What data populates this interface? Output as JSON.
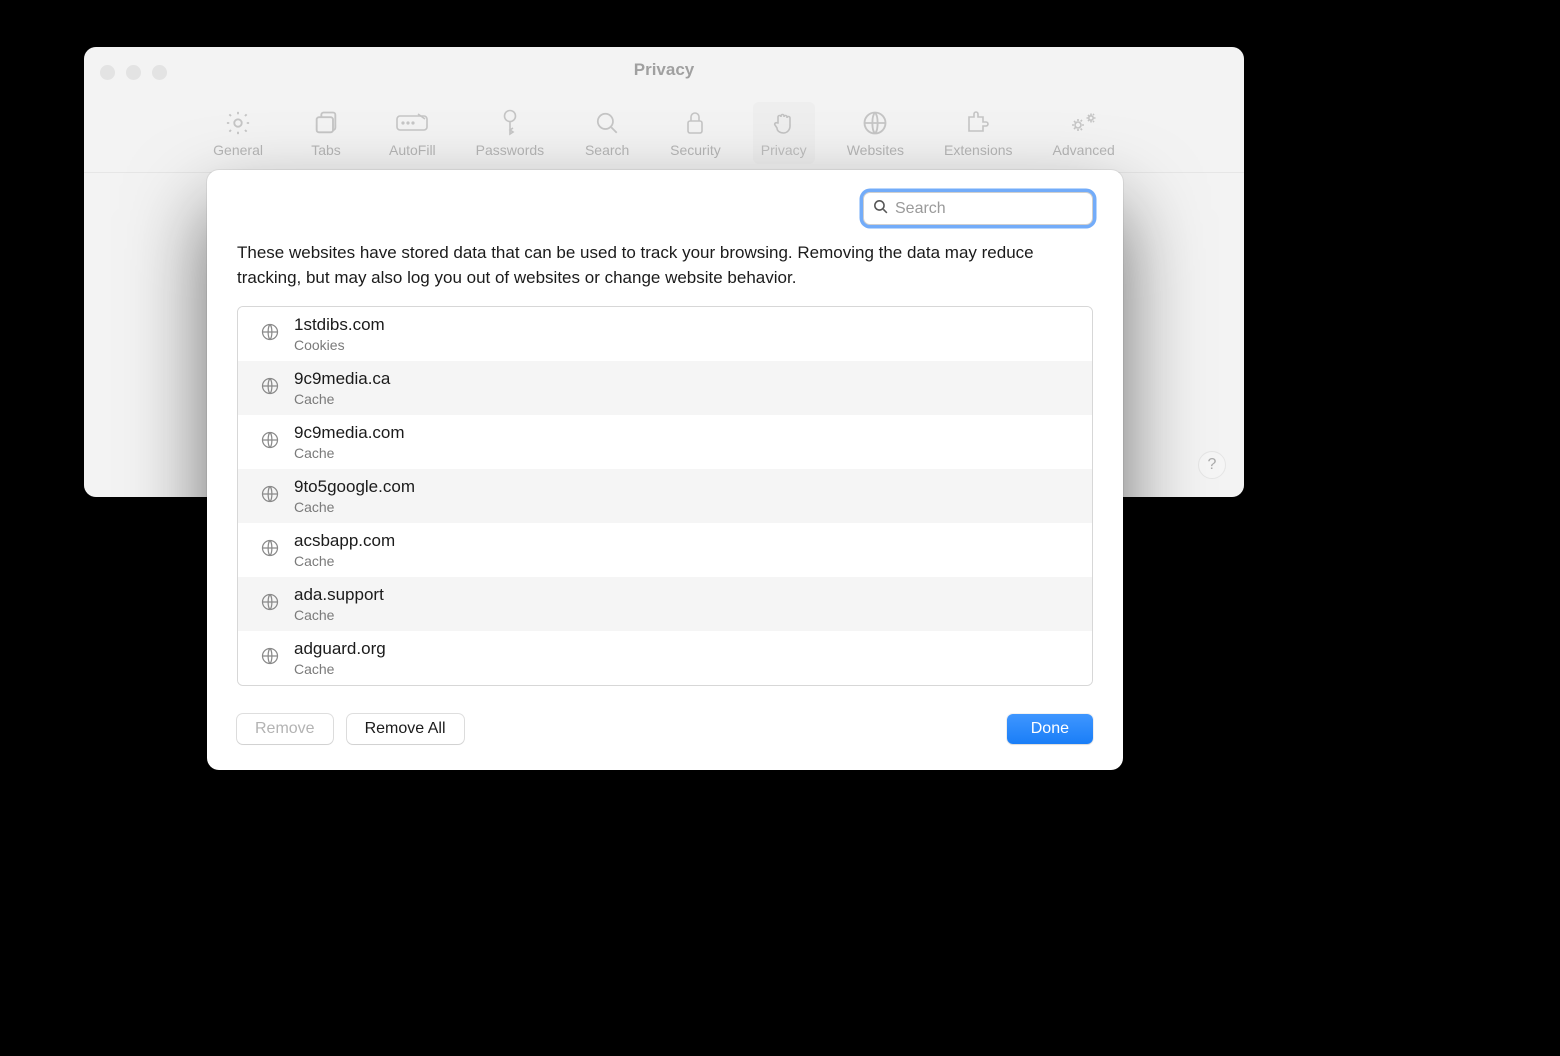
{
  "window": {
    "title": "Privacy"
  },
  "toolbar": {
    "items": [
      {
        "label": "General"
      },
      {
        "label": "Tabs"
      },
      {
        "label": "AutoFill"
      },
      {
        "label": "Passwords"
      },
      {
        "label": "Search"
      },
      {
        "label": "Security"
      },
      {
        "label": "Privacy"
      },
      {
        "label": "Websites"
      },
      {
        "label": "Extensions"
      },
      {
        "label": "Advanced"
      }
    ]
  },
  "sheet": {
    "search_placeholder": "Search",
    "description": "These websites have stored data that can be used to track your browsing. Removing the data may reduce tracking, but may also log you out of websites or change website behavior.",
    "rows": [
      {
        "domain": "1stdibs.com",
        "detail": "Cookies"
      },
      {
        "domain": "9c9media.ca",
        "detail": "Cache"
      },
      {
        "domain": "9c9media.com",
        "detail": "Cache"
      },
      {
        "domain": "9to5google.com",
        "detail": "Cache"
      },
      {
        "domain": "acsbapp.com",
        "detail": "Cache"
      },
      {
        "domain": "ada.support",
        "detail": "Cache"
      },
      {
        "domain": "adguard.org",
        "detail": "Cache"
      }
    ],
    "remove_label": "Remove",
    "remove_all_label": "Remove All",
    "done_label": "Done"
  },
  "help_label": "?"
}
